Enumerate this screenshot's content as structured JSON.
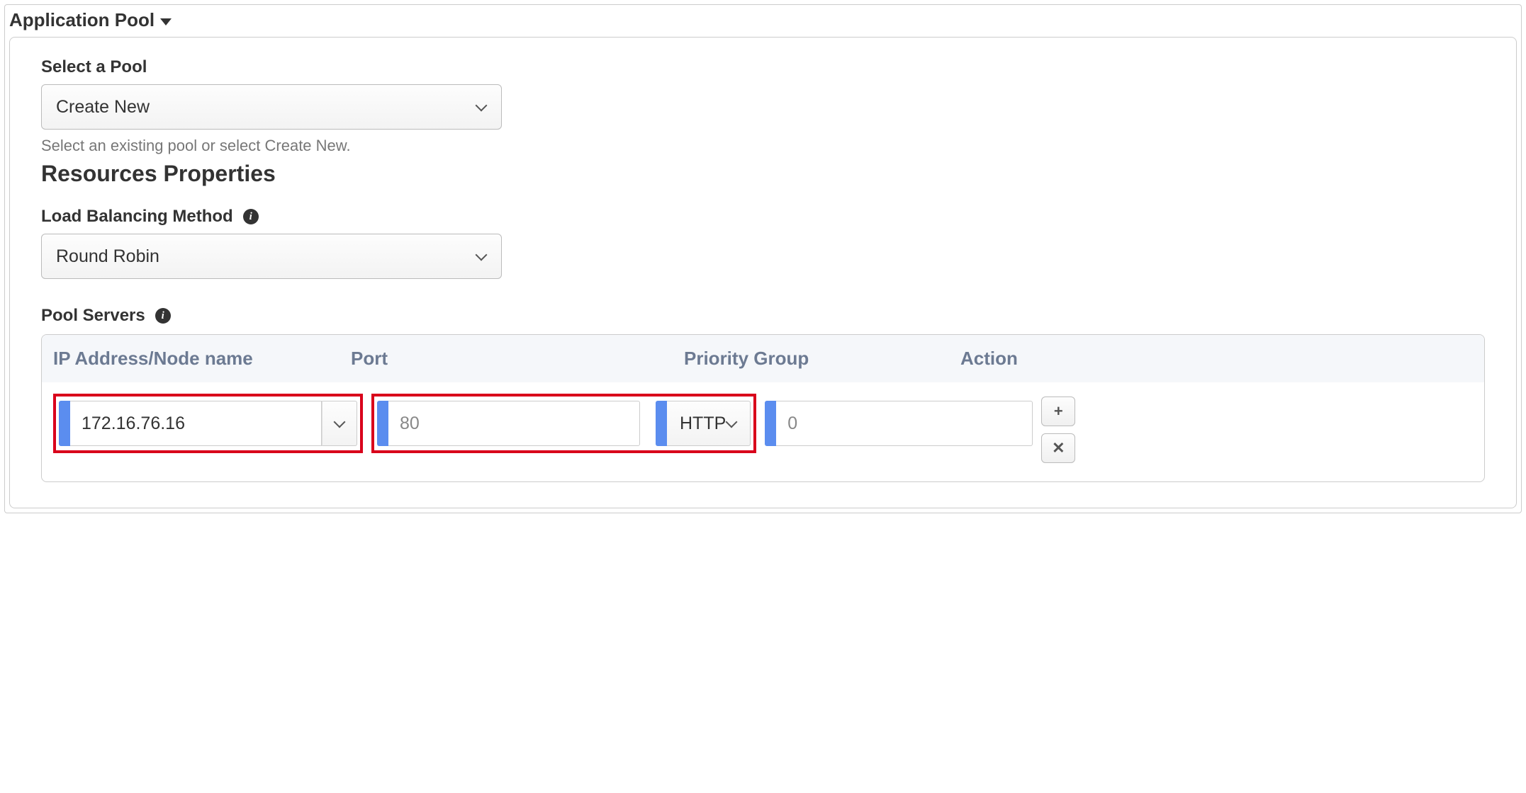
{
  "panel": {
    "title": "Application Pool"
  },
  "select_pool": {
    "label": "Select a Pool",
    "value": "Create New",
    "hint": "Select an existing pool or select Create New."
  },
  "resources_heading": "Resources Properties",
  "lb_method": {
    "label": "Load Balancing Method",
    "value": "Round Robin"
  },
  "pool_servers": {
    "label": "Pool Servers",
    "columns": {
      "ip": "IP Address/Node name",
      "port": "Port",
      "priority": "Priority Group",
      "action": "Action"
    },
    "row": {
      "ip": "172.16.76.16",
      "port_placeholder": "80",
      "protocol": "HTTP",
      "priority_placeholder": "0"
    },
    "actions": {
      "add": "+",
      "remove": "✕"
    }
  }
}
